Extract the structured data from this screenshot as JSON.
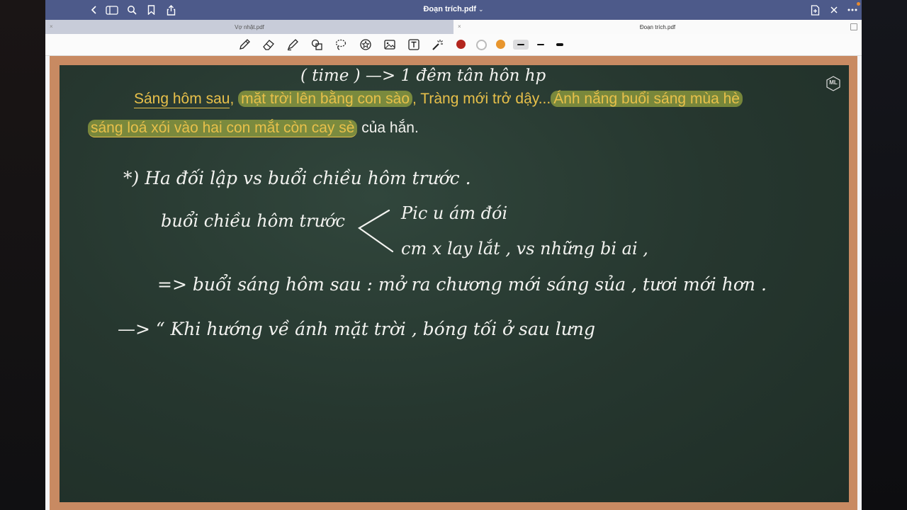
{
  "topbar": {
    "title": "Đoạn trích.pdf",
    "title_chevron": "⌄",
    "icons": [
      "back-icon",
      "sidebar-icon",
      "search-icon",
      "bookmark-icon",
      "share-icon",
      "add-page-icon",
      "close-icon",
      "more-icon"
    ]
  },
  "tabs": [
    {
      "label": "Vợ nhặt.pdf",
      "active": false,
      "close": "×"
    },
    {
      "label": "Đoạn trích.pdf",
      "active": true,
      "close": "×"
    }
  ],
  "toolbar": {
    "tools": [
      "pen-icon",
      "eraser-icon",
      "highlighter-icon",
      "shapes-icon",
      "lasso-icon",
      "sticker-icon",
      "image-icon",
      "text-icon",
      "laser-pointer-icon"
    ],
    "colors": [
      "#b3261e",
      "#ffffff",
      "#e8962e"
    ],
    "stroke_widths": [
      "thin",
      "medium",
      "thick"
    ]
  },
  "board": {
    "logo": "ML",
    "printed_line1": {
      "part1": "Sáng hôm sau",
      "sep1": ", ",
      "part2": "mặt trời lên bằng con sào",
      "part3": ", Tràng mới trở dậy...",
      "part4": "Ánh nắng buổi sáng mùa hè"
    },
    "printed_line2": {
      "part1": "sáng loá xói vào hai con mắt còn cay sè",
      "part2": " của hắn."
    },
    "handwriting": {
      "top": "( time ) —> 1 đêm tân hôn hp",
      "line1": "*) Ha đối lập vs buổi chiều hôm trước .",
      "line2_left": "buổi chiều hôm trước",
      "branch1": "Pic  u ám đói ",
      "branch2": "cm x  lay lắt , vs những bi ai ,",
      "line3": "=> buổi sáng hôm sau  :  mở ra chương mới sáng sủa , tươi mới hơn .",
      "line4": "—> “ Khi hướng về ánh mặt trời , bóng tối ở sau lưng"
    }
  }
}
